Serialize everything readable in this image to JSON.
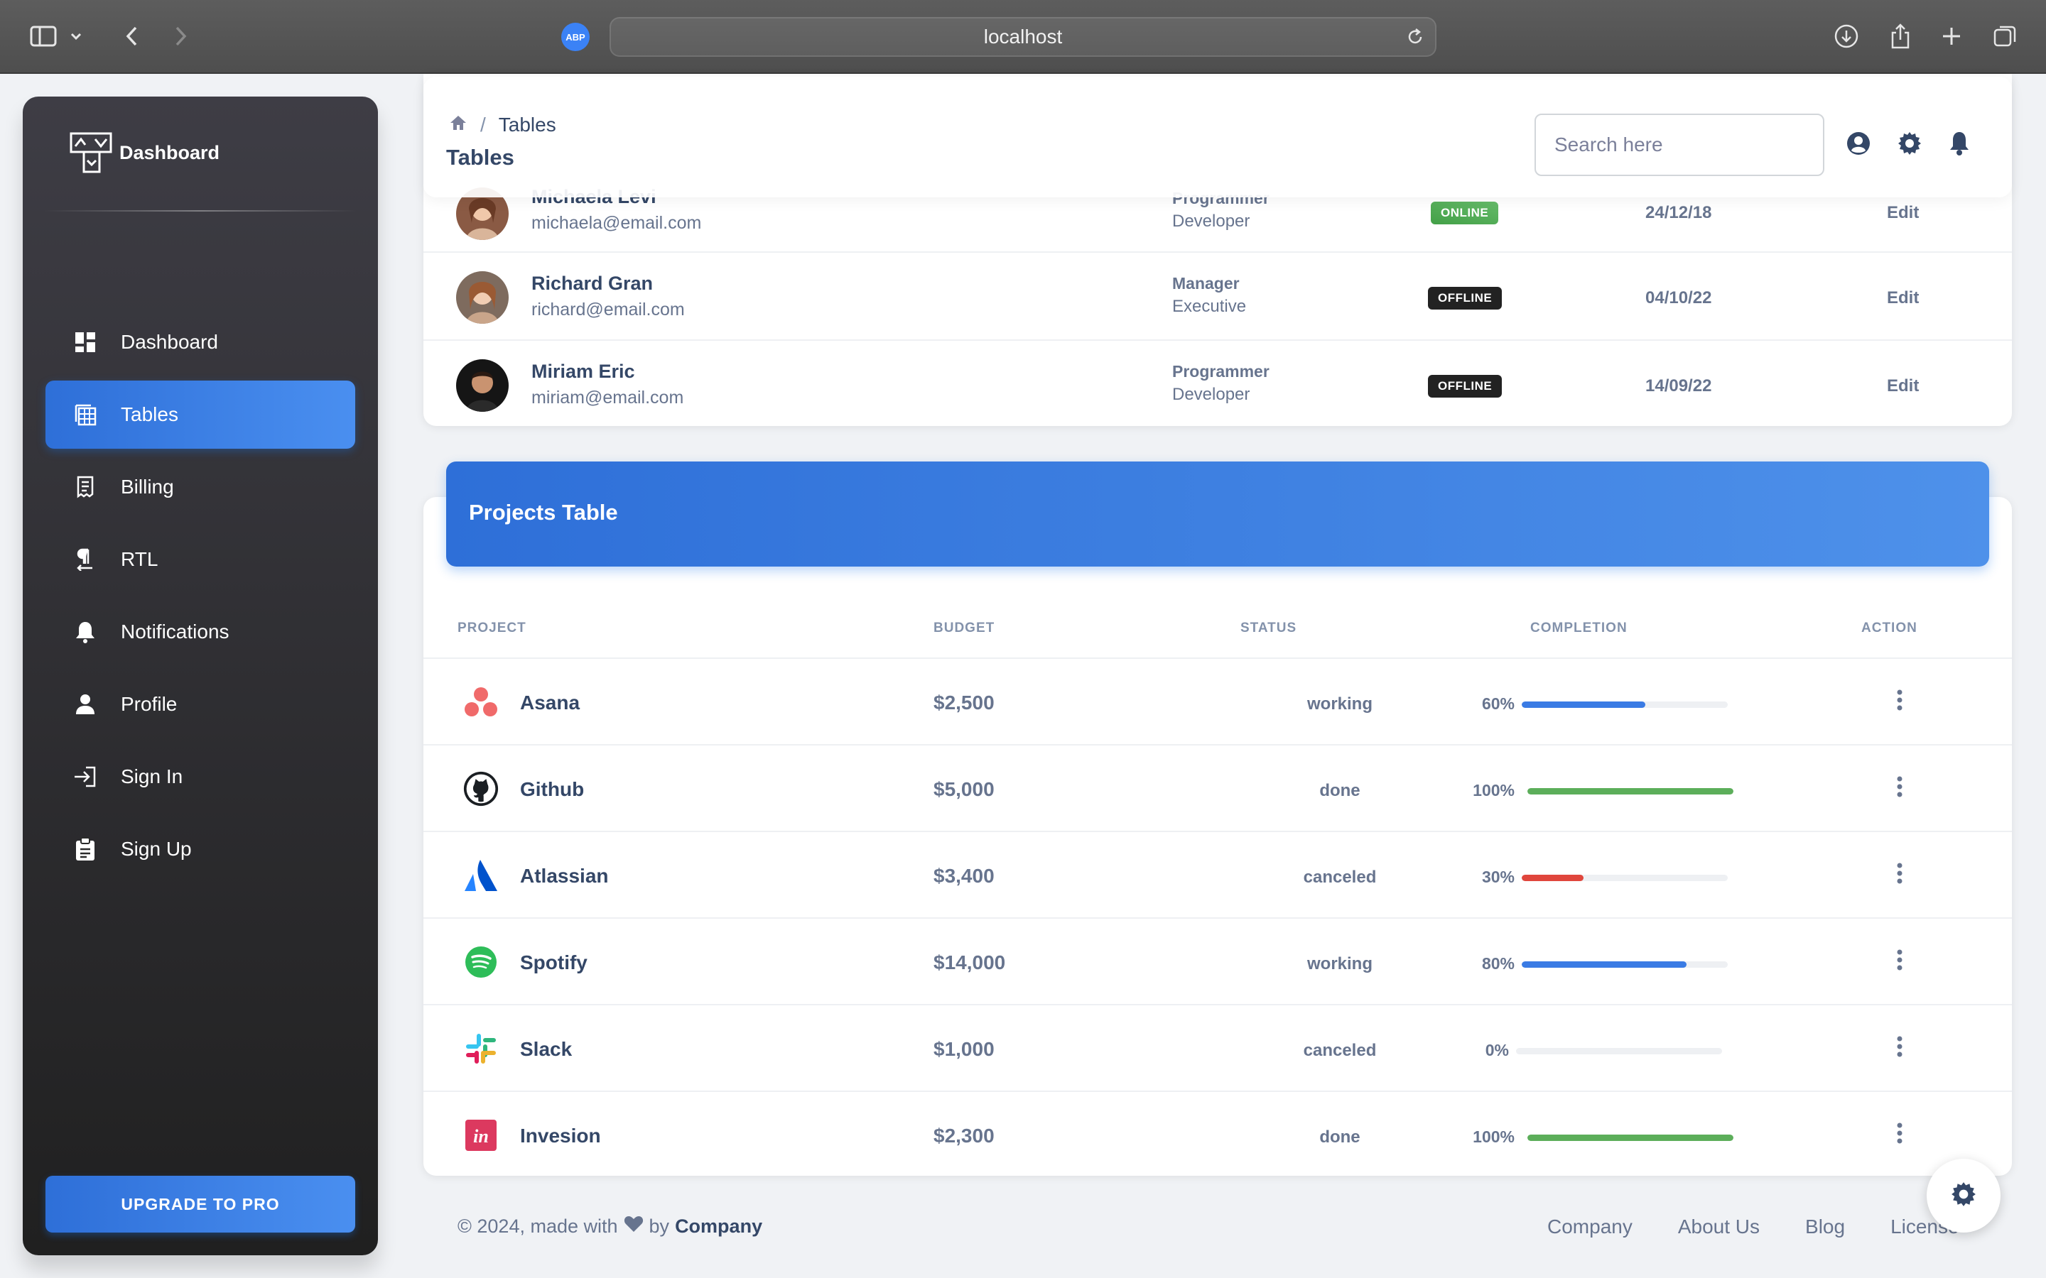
{
  "browser": {
    "url": "localhost",
    "abp_label": "ABP"
  },
  "sidebar": {
    "brand": "Dashboard",
    "items": [
      {
        "label": "Dashboard",
        "icon": "dashboard-icon"
      },
      {
        "label": "Tables",
        "icon": "table-icon",
        "active": true
      },
      {
        "label": "Billing",
        "icon": "receipt-icon"
      },
      {
        "label": "RTL",
        "icon": "rtl-icon"
      },
      {
        "label": "Notifications",
        "icon": "bell-icon"
      },
      {
        "label": "Profile",
        "icon": "person-icon"
      },
      {
        "label": "Sign In",
        "icon": "login-icon"
      },
      {
        "label": "Sign Up",
        "icon": "clipboard-icon"
      }
    ],
    "upgrade_label": "UPGRADE TO PRO"
  },
  "navbar": {
    "breadcrumb_current": "Tables",
    "page_title": "Tables",
    "search_placeholder": "Search here"
  },
  "authors": {
    "rows": [
      {
        "name": "Michaela Levi",
        "email": "michaela@email.com",
        "function": "Programmer",
        "role": "Developer",
        "status": "ONLINE",
        "date": "24/12/18",
        "action": "Edit"
      },
      {
        "name": "Richard Gran",
        "email": "richard@email.com",
        "function": "Manager",
        "role": "Executive",
        "status": "OFFLINE",
        "date": "04/10/22",
        "action": "Edit"
      },
      {
        "name": "Miriam Eric",
        "email": "miriam@email.com",
        "function": "Programmer",
        "role": "Developer",
        "status": "OFFLINE",
        "date": "14/09/22",
        "action": "Edit"
      }
    ]
  },
  "projects": {
    "title": "Projects Table",
    "columns": {
      "project": "PROJECT",
      "budget": "BUDGET",
      "status": "STATUS",
      "completion": "COMPLETION",
      "action": "ACTION"
    },
    "rows": [
      {
        "name": "Asana",
        "budget": "$2,500",
        "status": "working",
        "completion_label": "60%",
        "completion": 0.6,
        "bar_color": "#3a7be4"
      },
      {
        "name": "Github",
        "budget": "$5,000",
        "status": "done",
        "completion_label": "100%",
        "completion": 1.0,
        "bar_color": "#5cae5a"
      },
      {
        "name": "Atlassian",
        "budget": "$3,400",
        "status": "canceled",
        "completion_label": "30%",
        "completion": 0.3,
        "bar_color": "#e0463c"
      },
      {
        "name": "Spotify",
        "budget": "$14,000",
        "status": "working",
        "completion_label": "80%",
        "completion": 0.8,
        "bar_color": "#3a7be4"
      },
      {
        "name": "Slack",
        "budget": "$1,000",
        "status": "canceled",
        "completion_label": "0%",
        "completion": 0.0,
        "bar_color": "#e0463c"
      },
      {
        "name": "Invesion",
        "budget": "$2,300",
        "status": "done",
        "completion_label": "100%",
        "completion": 1.0,
        "bar_color": "#5cae5a"
      }
    ]
  },
  "footer": {
    "copyright": "© 2024, made with",
    "by": "by",
    "company": "Company",
    "links": [
      "Company",
      "About Us",
      "Blog",
      "License"
    ]
  },
  "colors": {
    "accent": "#2e6fd8",
    "online": "#4caf50",
    "offline": "#222222"
  }
}
